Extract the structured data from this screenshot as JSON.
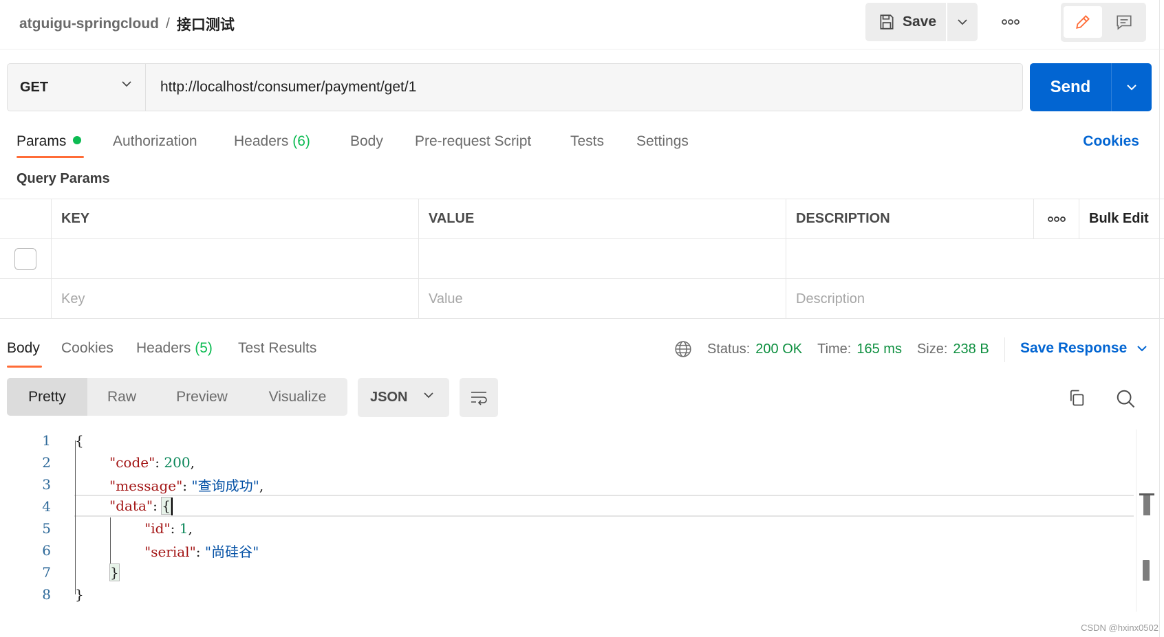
{
  "header": {
    "collection": "atguigu-springcloud",
    "separator": "/",
    "request_name": "接口测试",
    "save_label": "Save"
  },
  "request": {
    "method": "GET",
    "url": "http://localhost/consumer/payment/get/1",
    "send_label": "Send"
  },
  "request_tabs": {
    "params": "Params",
    "authorization": "Authorization",
    "headers": "Headers",
    "headers_count": "(6)",
    "body": "Body",
    "prerequest": "Pre-request Script",
    "tests": "Tests",
    "settings": "Settings",
    "cookies": "Cookies"
  },
  "query_params": {
    "title": "Query Params",
    "columns": {
      "key": "KEY",
      "value": "VALUE",
      "description": "DESCRIPTION"
    },
    "bulk_edit": "Bulk Edit",
    "placeholders": {
      "key": "Key",
      "value": "Value",
      "description": "Description"
    }
  },
  "response": {
    "tabs": {
      "body": "Body",
      "cookies": "Cookies",
      "headers": "Headers",
      "headers_count": "(5)",
      "test_results": "Test Results"
    },
    "status_label": "Status:",
    "status_value": "200 OK",
    "time_label": "Time:",
    "time_value": "165 ms",
    "size_label": "Size:",
    "size_value": "238 B",
    "save_response": "Save Response",
    "views": {
      "pretty": "Pretty",
      "raw": "Raw",
      "preview": "Preview",
      "visualize": "Visualize"
    },
    "format": "JSON"
  },
  "code": {
    "line_numbers": [
      "1",
      "2",
      "3",
      "4",
      "5",
      "6",
      "7",
      "8"
    ],
    "open_brace": "{",
    "close_brace": "}",
    "code_key": "\"code\"",
    "code_value": "200",
    "message_key": "\"message\"",
    "message_value": "\"查询成功\"",
    "data_key": "\"data\"",
    "id_key": "\"id\"",
    "id_value": "1",
    "serial_key": "\"serial\"",
    "serial_value": "\"尚硅谷\"",
    "colon": ": ",
    "comma": ","
  },
  "watermark": "CSDN @hxinx0502",
  "colors": {
    "accent_orange": "#ff6c37",
    "send_blue": "#0265d2",
    "status_green": "#0d8f3f",
    "json_key": "#a31515",
    "json_number": "#098658",
    "json_string": "#0451a5"
  },
  "icons": {
    "save": "floppy-disk-icon",
    "more": "more-horizontal-icon",
    "edit": "pencil-icon",
    "comment": "comment-icon",
    "globe": "globe-icon",
    "wrap": "wrap-lines-icon",
    "copy": "copy-icon",
    "search": "search-icon"
  }
}
